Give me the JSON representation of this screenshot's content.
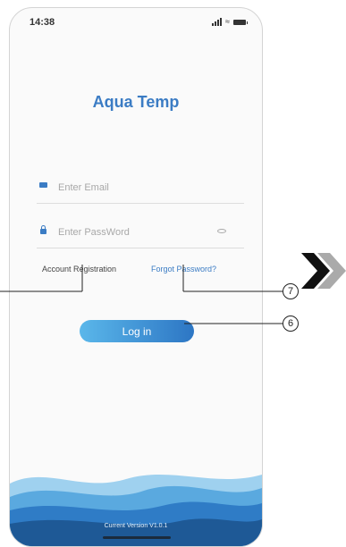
{
  "status_bar": {
    "time": "14:38"
  },
  "app": {
    "title": "Aqua Temp"
  },
  "login_form": {
    "email_placeholder": "Enter Email",
    "password_placeholder": "Enter PassWord",
    "account_registration": "Account Registration",
    "forgot_password": "Forgot Password?",
    "login_button": "Log in"
  },
  "footer": {
    "version": "Current Version V1.0.1"
  },
  "callouts": {
    "forgot": "7",
    "login": "6"
  },
  "colors": {
    "brand": "#3b7cc4",
    "button_start": "#5ab7ea",
    "button_end": "#2d76c4",
    "wave_dark": "#1e5996"
  }
}
